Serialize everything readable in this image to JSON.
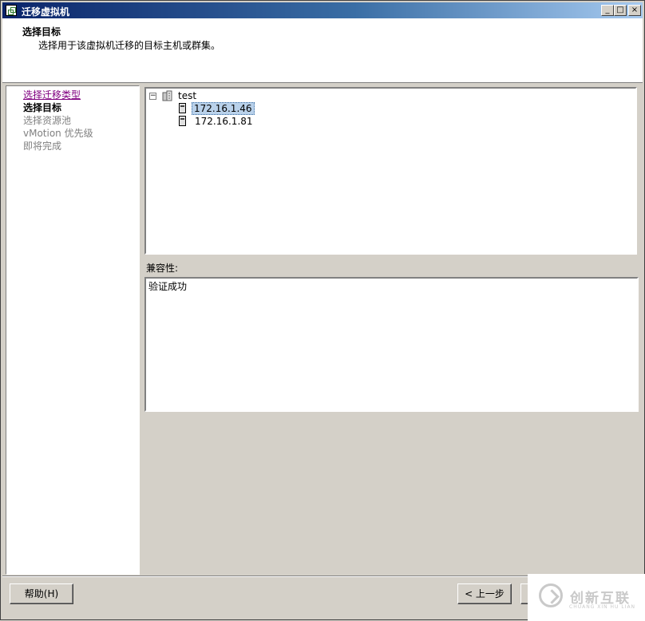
{
  "window": {
    "title": "迁移虚拟机",
    "controls": {
      "minimize": "_",
      "maximize": "□",
      "close": "×"
    }
  },
  "header": {
    "title": "选择目标",
    "subtitle": "选择用于该虚拟机迁移的目标主机或群集。"
  },
  "nav": {
    "items": [
      {
        "label": "选择迁移类型",
        "state": "visited"
      },
      {
        "label": "选择目标",
        "state": "current"
      },
      {
        "label": "选择资源池",
        "state": "disabled"
      },
      {
        "label": "vMotion 优先级",
        "state": "disabled"
      },
      {
        "label": "即将完成",
        "state": "disabled"
      }
    ]
  },
  "tree": {
    "expander": "−",
    "cluster": {
      "label": "test",
      "icon": "cluster-icon"
    },
    "hosts": [
      {
        "label": "172.16.1.46",
        "selected": true,
        "icon": "host-icon"
      },
      {
        "label": "172.16.1.81",
        "selected": false,
        "icon": "host-icon"
      }
    ]
  },
  "compatibility": {
    "label": "兼容性:",
    "message": "验证成功"
  },
  "buttons": {
    "help": "帮助(H)",
    "back": "< 上一步"
  },
  "watermark": {
    "text_cn": "创新互联",
    "text_en": "CHUANG XIN HU LIAN"
  }
}
